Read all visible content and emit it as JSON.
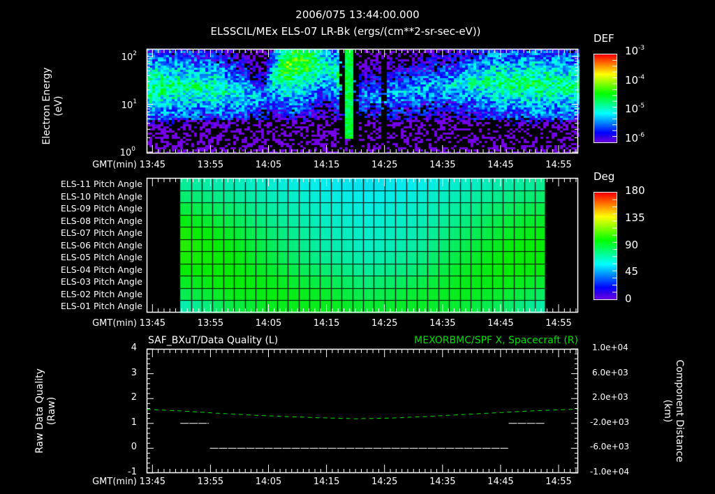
{
  "header": {
    "date_time": "2006/075 13:44:00.000",
    "title": "ELSSCIL/MEx ELS-07 LR-Bk  (ergs/(cm**2-sr-sec-eV))"
  },
  "time_axis": {
    "label": "GMT(min)",
    "ticks": [
      "13:45",
      "13:55",
      "14:05",
      "14:15",
      "14:25",
      "14:35",
      "14:45",
      "14:55"
    ],
    "tick_minutes": [
      45,
      55,
      65,
      75,
      85,
      95,
      105,
      115
    ],
    "range_minutes_after_13h": [
      44,
      118.4
    ]
  },
  "chart_data": [
    {
      "type": "heatmap",
      "name": "electron-spectrogram",
      "ylabel_line1": "Electron Energy",
      "ylabel_line2": "(eV)",
      "yscale": "log",
      "ylim_eV": [
        1,
        145
      ],
      "yticks": [
        {
          "base": "10",
          "exp": "2",
          "value": 100
        },
        {
          "base": "10",
          "exp": "1",
          "value": 10
        },
        {
          "base": "10",
          "exp": "0",
          "value": 1
        }
      ],
      "colorbar": {
        "title": "DEF",
        "scale": "log",
        "range_log10": [
          -6,
          -3
        ],
        "ticks": [
          {
            "base": "10",
            "exp": "-3"
          },
          {
            "base": "10",
            "exp": "-4"
          },
          {
            "base": "10",
            "exp": "-5"
          },
          {
            "base": "10",
            "exp": "-6"
          }
        ]
      },
      "profile_minutes": [
        44,
        50,
        56,
        60,
        64,
        68,
        72,
        75,
        77,
        80,
        84,
        90,
        96,
        100,
        104,
        110,
        118
      ],
      "peak_energy_eV": [
        25,
        25,
        22,
        18,
        12,
        70,
        80,
        60,
        40,
        15,
        15,
        20,
        25,
        30,
        30,
        28,
        25
      ],
      "peak_log10_def": [
        -4.1,
        -4.2,
        -4.3,
        -4.5,
        -4.9,
        -3.7,
        -3.9,
        -4.4,
        -4.2,
        -5.0,
        -4.8,
        -4.7,
        -4.6,
        -4.4,
        -4.2,
        -4.1,
        -4.2
      ],
      "dropout_minutes": [
        [
          76.8,
          78.0
        ],
        [
          79.6,
          80.2
        ],
        [
          84.2,
          85.2
        ]
      ]
    },
    {
      "type": "heatmap",
      "name": "pitch-angle",
      "rows": [
        "ELS-11 Pitch Angle",
        "ELS-10 Pitch Angle",
        "ELS-09 Pitch Angle",
        "ELS-08 Pitch Angle",
        "ELS-07 Pitch Angle",
        "ELS-06 Pitch Angle",
        "ELS-05 Pitch Angle",
        "ELS-04 Pitch Angle",
        "ELS-03 Pitch Angle",
        "ELS-02 Pitch Angle",
        "ELS-01 Pitch Angle"
      ],
      "colorbar": {
        "title": "Deg",
        "range": [
          0,
          180
        ],
        "ticks": [
          "180",
          "135",
          "90",
          "45",
          "0"
        ]
      },
      "coverage_minutes": [
        49.8,
        112.6
      ],
      "anchor_minutes": [
        50,
        58,
        66,
        74,
        82,
        90,
        98,
        106,
        112
      ],
      "values_deg": [
        [
          75,
          70,
          64,
          60,
          58,
          60,
          66,
          72,
          76
        ],
        [
          82,
          76,
          68,
          63,
          60,
          63,
          70,
          78,
          82
        ],
        [
          90,
          82,
          72,
          66,
          62,
          66,
          74,
          84,
          88
        ],
        [
          98,
          88,
          76,
          68,
          64,
          68,
          78,
          90,
          94
        ],
        [
          104,
          94,
          80,
          70,
          66,
          70,
          82,
          94,
          98
        ],
        [
          106,
          98,
          84,
          72,
          67,
          72,
          86,
          98,
          100
        ],
        [
          104,
          100,
          88,
          76,
          70,
          76,
          90,
          100,
          100
        ],
        [
          100,
          100,
          92,
          82,
          74,
          80,
          94,
          100,
          98
        ],
        [
          94,
          100,
          96,
          88,
          80,
          86,
          96,
          98,
          92
        ],
        [
          86,
          96,
          98,
          94,
          86,
          92,
          96,
          92,
          84
        ],
        [
          70,
          88,
          96,
          96,
          92,
          94,
          92,
          84,
          72
        ]
      ]
    },
    {
      "type": "line",
      "name": "quality-and-position",
      "left_title": "SAF_BXuT/Data Quality (L)",
      "right_title": "MEXORBMC/SPF X, Spacecraft (R)",
      "left_ylabel_line1": "Raw Data Quality",
      "left_ylabel_line2": "(Raw)",
      "left_ylim": [
        -1,
        4
      ],
      "left_ticks": [
        "4",
        "3",
        "2",
        "1",
        "0",
        "-1"
      ],
      "right_ylabel_line1": "Component Distance",
      "right_ylabel_line2": "(km)",
      "right_ylim": [
        -10000,
        10000
      ],
      "right_ticks": [
        "1.0e+04",
        "6.0e+03",
        "2.0e+03",
        "-2.0e+03",
        "-6.0e+03",
        "-1.0e+04"
      ],
      "series": [
        {
          "name": "Data Quality",
          "axis": "left",
          "color": "#ffffff",
          "style": "solid",
          "segments": [
            {
              "x": [
                49.8,
                54.7
              ],
              "y": 1
            },
            {
              "x": [
                54.9,
                106.3
              ],
              "y": 0
            },
            {
              "x": [
                106.4,
                112.6
              ],
              "y": 1
            }
          ]
        },
        {
          "name": "Spacecraft X",
          "axis": "right",
          "color": "#00e000",
          "style": "dashed",
          "x": [
            44,
            50,
            56,
            62,
            68,
            74,
            80,
            86,
            92,
            98,
            104,
            110,
            118
          ],
          "y": [
            250,
            0,
            -350,
            -650,
            -900,
            -1100,
            -1250,
            -1150,
            -900,
            -600,
            -300,
            0,
            300
          ]
        }
      ]
    }
  ],
  "colors": {
    "background": "#000000",
    "axis": "#ffffff",
    "spacecraft_line": "#00e000"
  }
}
